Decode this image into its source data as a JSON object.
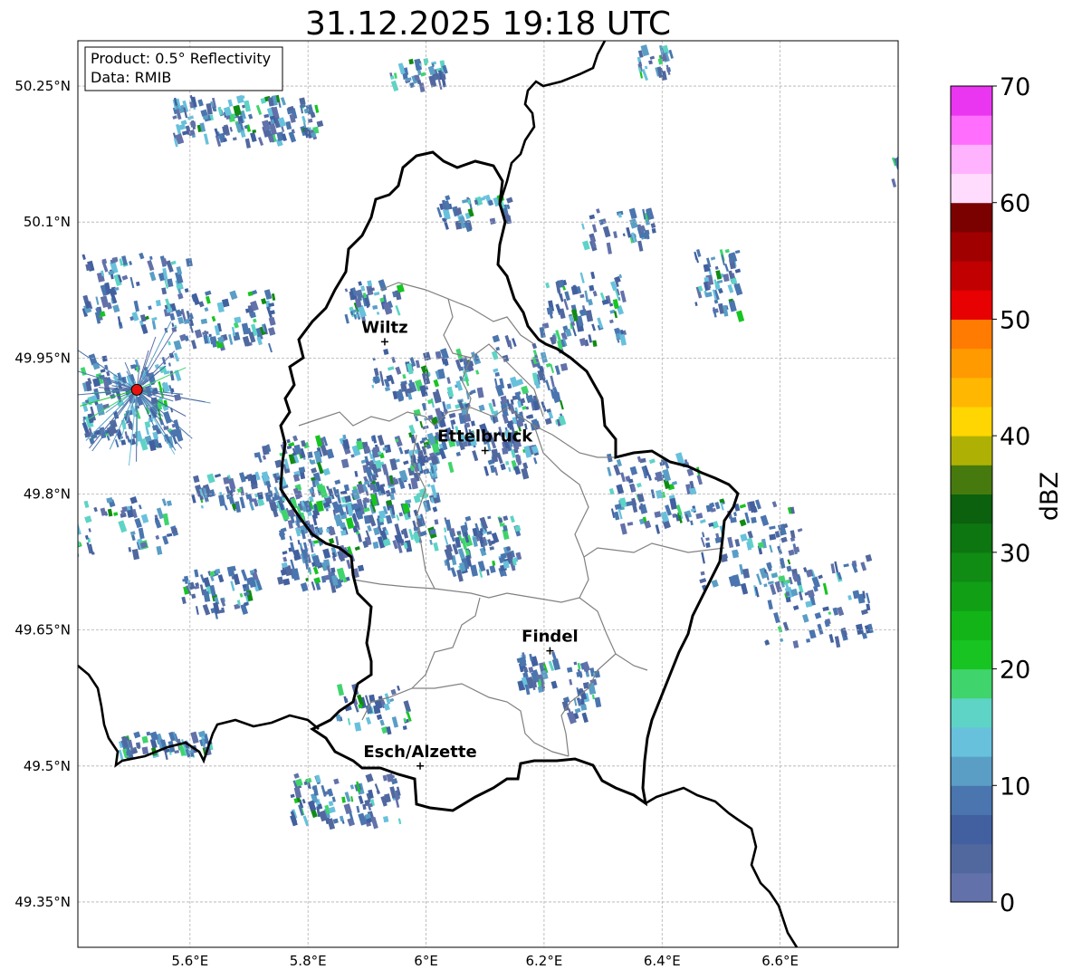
{
  "title": "31.12.2025 19:18 UTC",
  "info": {
    "product": "Product: 0.5° Reflectivity",
    "data": "Data: RMIB"
  },
  "axes": {
    "x_ticks": [
      "5.6°E",
      "5.8°E",
      "6°E",
      "6.2°E",
      "6.4°E",
      "6.6°E"
    ],
    "y_ticks": [
      "50.25°N",
      "50.1°N",
      "49.95°N",
      "49.8°N",
      "49.65°N",
      "49.5°N",
      "49.35°N"
    ],
    "x_values": [
      5.6,
      5.8,
      6.0,
      6.2,
      6.4,
      6.6
    ],
    "y_values": [
      50.25,
      50.1,
      49.95,
      49.8,
      49.65,
      49.5,
      49.35
    ],
    "xlim": [
      5.41,
      6.8
    ],
    "ylim": [
      49.3,
      50.3
    ]
  },
  "cities": [
    {
      "name": "Wiltz",
      "lon": 5.93,
      "lat": 49.968
    },
    {
      "name": "Ettelbruck",
      "lon": 6.1,
      "lat": 49.848
    },
    {
      "name": "Findel",
      "lon": 6.21,
      "lat": 49.627
    },
    {
      "name": "Esch/Alzette",
      "lon": 5.99,
      "lat": 49.5
    }
  ],
  "radar_site": {
    "lon": 5.51,
    "lat": 49.915,
    "color": "#e8130f"
  },
  "colorbar": {
    "label": "dBZ",
    "ticks": [
      "0",
      "10",
      "20",
      "30",
      "40",
      "50",
      "60",
      "70"
    ],
    "tick_values": [
      0,
      10,
      20,
      30,
      40,
      50,
      60,
      70
    ],
    "range": [
      0,
      70
    ],
    "colors": [
      "#6271a9",
      "#51689f",
      "#42609f",
      "#4a75ae",
      "#5a9ec6",
      "#68c1dc",
      "#5dd4c5",
      "#3fd46c",
      "#18c421",
      "#13b417",
      "#119f15",
      "#108b13",
      "#0d7610",
      "#0b610d",
      "#477a0e",
      "#aeb104",
      "#ffd601",
      "#ffb701",
      "#ff9a01",
      "#ff7b02",
      "#e70102",
      "#c10001",
      "#a00000",
      "#7b0000",
      "#ffdcfd",
      "#ffb2fd",
      "#ff6efd",
      "#ea35f1"
    ]
  }
}
